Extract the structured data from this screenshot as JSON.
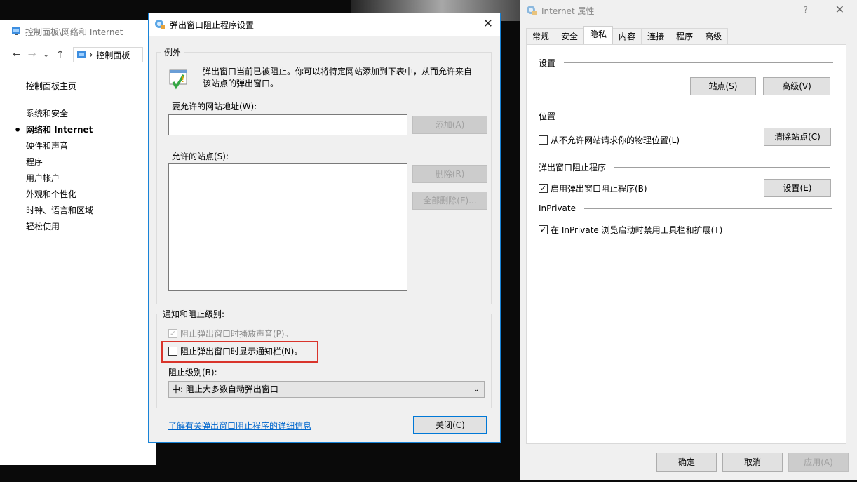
{
  "control_panel": {
    "title": "控制面板\\网络和 Internet",
    "address": "控制面板",
    "home_link": "控制面板主页",
    "items": [
      {
        "label": "系统和安全",
        "active": false
      },
      {
        "label": "网络和 Internet",
        "active": true
      },
      {
        "label": "硬件和声音",
        "active": false
      },
      {
        "label": "程序",
        "active": false
      },
      {
        "label": "用户帐户",
        "active": false
      },
      {
        "label": "外观和个性化",
        "active": false
      },
      {
        "label": "时钟、语言和区域",
        "active": false
      },
      {
        "label": "轻松使用",
        "active": false
      }
    ]
  },
  "popup_dialog": {
    "title": "弹出窗口阻止程序设置",
    "exceptions_group": "例外",
    "info_text_line1": "弹出窗口当前已被阻止。你可以将特定网站添加到下表中，从而允许来自",
    "info_text_line2": "该站点的弹出窗口。",
    "address_label": "要允许的网站地址(W):",
    "address_value": "",
    "add_button": "添加(A)",
    "allowed_label": "允许的站点(S):",
    "allowed_sites": [],
    "remove_button": "删除(R)",
    "remove_all_button": "全部删除(E)...",
    "notify_group": "通知和阻止级别:",
    "play_sound": {
      "label": "阻止弹出窗口时播放声音(P)。",
      "checked": true,
      "enabled": false
    },
    "show_bar": {
      "label": "阻止弹出窗口时显示通知栏(N)。",
      "checked": false,
      "enabled": true
    },
    "block_level_label": "阻止级别(B):",
    "block_level_value": "中: 阻止大多数自动弹出窗口",
    "learn_more_link": "了解有关弹出窗口阻止程序的详细信息",
    "close_button": "关闭(C)",
    "highlight_color": "#d9342b"
  },
  "internet_properties": {
    "title": "Internet 属性",
    "help": "?",
    "tabs": [
      {
        "label": "常规",
        "active": false
      },
      {
        "label": "安全",
        "active": false
      },
      {
        "label": "隐私",
        "active": true
      },
      {
        "label": "内容",
        "active": false
      },
      {
        "label": "连接",
        "active": false
      },
      {
        "label": "程序",
        "active": false
      },
      {
        "label": "高级",
        "active": false
      }
    ],
    "settings_section": "设置",
    "sites_button": "站点(S)",
    "advanced_button": "高级(V)",
    "location_section": "位置",
    "location_checkbox": {
      "label": "从不允许网站请求你的物理位置(L)",
      "checked": false
    },
    "clear_sites_button": "清除站点(C)",
    "popup_section": "弹出窗口阻止程序",
    "popup_checkbox": {
      "label": "启用弹出窗口阻止程序(B)",
      "checked": true
    },
    "popup_settings_button": "设置(E)",
    "inprivate_section": "InPrivate",
    "inprivate_checkbox": {
      "label": "在 InPrivate 浏览启动时禁用工具栏和扩展(T)",
      "checked": true
    },
    "ok_button": "确定",
    "cancel_button": "取消",
    "apply_button": "应用(A)"
  }
}
